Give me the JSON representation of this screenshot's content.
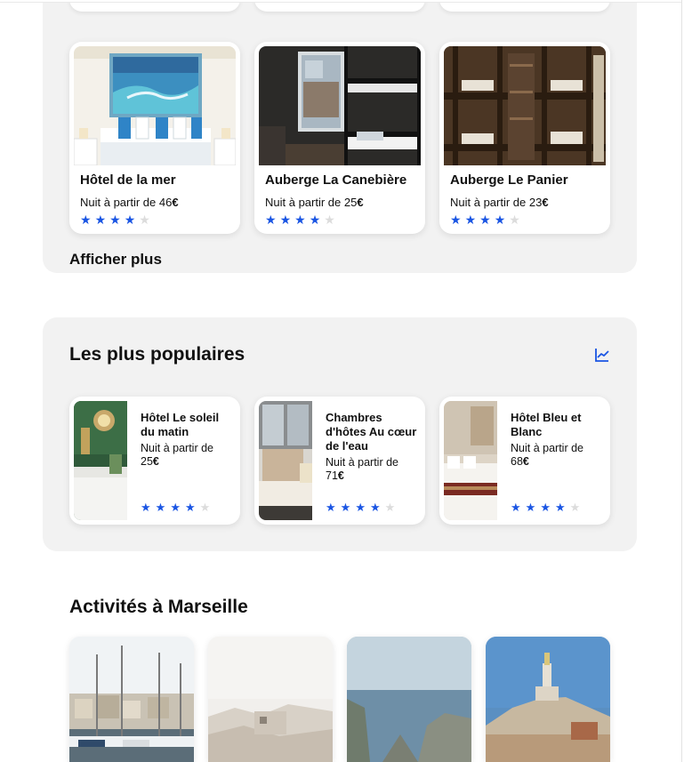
{
  "budget": {
    "cards": [
      {
        "name": "Hôtel de la mer",
        "price_prefix": "Nuit à partir de 46",
        "currency": "€",
        "rating": 4
      },
      {
        "name": "Auberge La Canebière",
        "price_prefix": "Nuit à partir de 25",
        "currency": "€",
        "rating": 4
      },
      {
        "name": "Auberge Le Panier",
        "price_prefix": "Nuit à partir de 23",
        "currency": "€",
        "rating": 4
      }
    ],
    "more_label": "Afficher plus"
  },
  "popular": {
    "title": "Les plus populaires",
    "icon": "trend-chart-icon",
    "cards": [
      {
        "name": "Hôtel Le soleil du matin",
        "price_line1": "Nuit à partir de",
        "price_line2": "25",
        "currency": "€",
        "rating": 4
      },
      {
        "name": "Chambres d'hôtes Au cœur de l'eau",
        "price_line1": "Nuit à partir de",
        "price_line2": "71",
        "currency": "€",
        "rating": 4
      },
      {
        "name": "Hôtel Bleu et Blanc",
        "price_line1": "Nuit à partir de",
        "price_line2": "68",
        "currency": "€",
        "rating": 4
      }
    ]
  },
  "activities": {
    "title": "Activités à Marseille"
  },
  "colors": {
    "accent": "#1a55e3",
    "section_bg": "#f2f2f2",
    "star_off": "#dcdcdc"
  }
}
